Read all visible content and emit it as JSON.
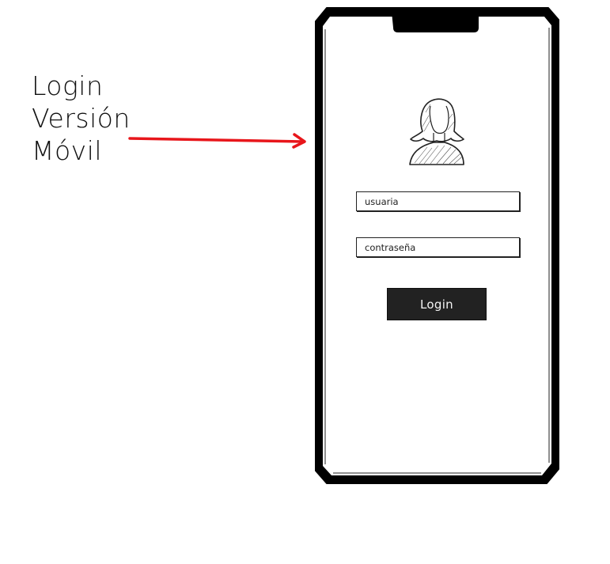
{
  "annotation": {
    "lines": [
      "Login",
      "Versión",
      "Móvil"
    ]
  },
  "colors": {
    "arrow": "#e8161b",
    "phone_frame": "#000000",
    "button_bg": "#222222",
    "button_text": "#f4f4f4"
  },
  "icons": {
    "avatar": "user-silhouette-icon",
    "arrow": "right-arrow-icon"
  },
  "form": {
    "username_placeholder": "usuaria",
    "password_placeholder": "contraseña",
    "login_label": "Login"
  }
}
